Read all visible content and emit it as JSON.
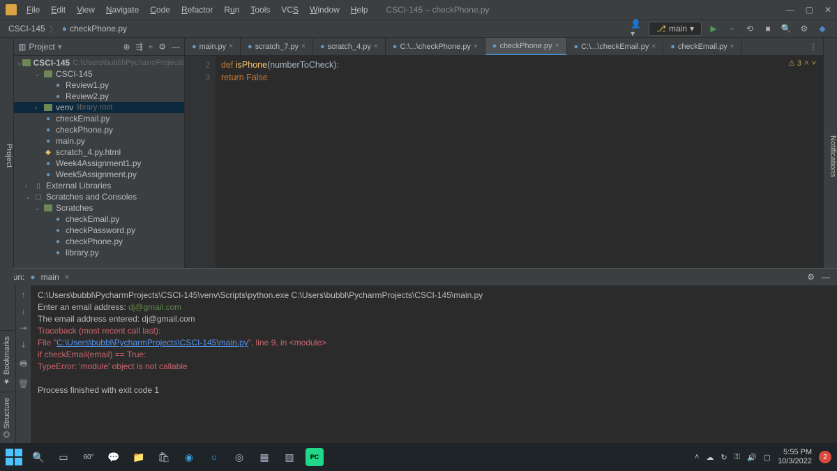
{
  "window": {
    "title": "CSCI-145 – checkPhone.py",
    "menus": [
      "File",
      "Edit",
      "View",
      "Navigate",
      "Code",
      "Refactor",
      "Run",
      "Tools",
      "VCS",
      "Window",
      "Help"
    ]
  },
  "breadcrumb": {
    "root": "CSCI-145",
    "file": "checkPhone.py"
  },
  "toolbar": {
    "branch": "main",
    "branch_icon": "⎇"
  },
  "project": {
    "header": "Project",
    "root": {
      "name": "CSCI-145",
      "path": "C:\\Users\\bubbl\\PycharmProjects\\CSCI-145"
    },
    "items": [
      {
        "indent": 1,
        "arrow": "⌄",
        "type": "folder",
        "name": "CSCI-145"
      },
      {
        "indent": 2,
        "type": "py",
        "name": "Review1.py"
      },
      {
        "indent": 2,
        "type": "py",
        "name": "Review2.py"
      },
      {
        "indent": 1,
        "arrow": "›",
        "type": "folder",
        "name": "venv",
        "dim": "library root",
        "selected": true
      },
      {
        "indent": 1,
        "type": "py",
        "name": "checkEmail.py"
      },
      {
        "indent": 1,
        "type": "py",
        "name": "checkPhone.py"
      },
      {
        "indent": 1,
        "type": "py",
        "name": "main.py"
      },
      {
        "indent": 1,
        "type": "html",
        "name": "scratch_4.py.html"
      },
      {
        "indent": 1,
        "type": "py",
        "name": "Week4Assignment1.py"
      },
      {
        "indent": 1,
        "type": "py",
        "name": "Week5Assignment.py"
      },
      {
        "indent": 0,
        "arrow": "›",
        "type": "lib",
        "name": "External Libraries"
      },
      {
        "indent": 0,
        "arrow": "⌄",
        "type": "scratch",
        "name": "Scratches and Consoles"
      },
      {
        "indent": 1,
        "arrow": "⌄",
        "type": "folder",
        "name": "Scratches"
      },
      {
        "indent": 2,
        "type": "py",
        "name": "checkEmail.py"
      },
      {
        "indent": 2,
        "type": "py",
        "name": "checkPassword.py"
      },
      {
        "indent": 2,
        "type": "py",
        "name": "checkPhone.py"
      },
      {
        "indent": 2,
        "type": "py",
        "name": "library.py"
      }
    ]
  },
  "tabs": [
    {
      "label": "main.py"
    },
    {
      "label": "scratch_7.py"
    },
    {
      "label": "scratch_4.py"
    },
    {
      "label": "C:\\...\\checkPhone.py"
    },
    {
      "label": "checkPhone.py",
      "active": true
    },
    {
      "label": "C:\\...\\checkEmail.py"
    },
    {
      "label": "checkEmail.py"
    }
  ],
  "code": {
    "status": "⚠ 3",
    "lines": [
      {
        "n": "",
        "html": "<span class='kw'>def</span> <span class='fn'>isPhone</span>(<span class='param'>numberToCheck</span>):"
      },
      {
        "n": "2",
        "html": "    <span class='kw'>return False</span>"
      },
      {
        "n": "3",
        "html": ""
      }
    ]
  },
  "run": {
    "label": "Run:",
    "config": "main",
    "output": {
      "cmd": "C:\\Users\\bubbl\\PycharmProjects\\CSCI-145\\venv\\Scripts\\python.exe C:\\Users\\bubbl\\PycharmProjects\\CSCI-145\\main.py",
      "prompt": "Enter an email address: ",
      "userinput": "dj@gmail.com",
      "echo": "The email address entered: dj@gmail.com",
      "trace1": "Traceback (most recent call last):",
      "trace2a": "  File \"",
      "trace2link": "C:\\Users\\bubbl\\PycharmProjects\\CSCI-145\\main.py",
      "trace2b": "\", line 9, in <module>",
      "trace3": "    if checkEmail(email) == True:",
      "err": "TypeError: 'module' object is not callable",
      "exit": "Process finished with exit code 1"
    }
  },
  "left_tools": [
    "Bookmarks",
    "Structure"
  ],
  "left_gutter": "Project",
  "right_gutter": "Notifications",
  "taskbar": {
    "weather": "60°",
    "time": "5:55 PM",
    "date": "10/3/2022",
    "notif_count": "2"
  }
}
